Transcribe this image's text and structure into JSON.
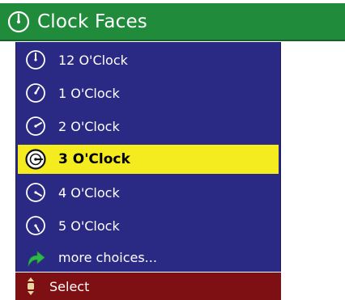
{
  "colors": {
    "title_bar": "#218b3c",
    "menu_background": "#2a2a85",
    "selection_highlight": "#f4ec1e",
    "status_bar": "#7e0f12",
    "more_choices_arrow": "#2fb84a"
  },
  "header": {
    "icon": "clock-icon",
    "title": "Clock Faces"
  },
  "menu": {
    "items": [
      {
        "label": "12 O'Clock",
        "icon": "clock-12-icon",
        "hand_angle": 0,
        "selected": false
      },
      {
        "label": "1 O'Clock",
        "icon": "clock-1-icon",
        "hand_angle": 30,
        "selected": false
      },
      {
        "label": "2 O'Clock",
        "icon": "clock-2-icon",
        "hand_angle": 60,
        "selected": false
      },
      {
        "label": "3 O'Clock",
        "icon": "clock-3-icon",
        "hand_angle": 90,
        "selected": true
      },
      {
        "label": "4 O'Clock",
        "icon": "clock-4-icon",
        "hand_angle": 120,
        "selected": false
      },
      {
        "label": "5 O'Clock",
        "icon": "clock-5-icon",
        "hand_angle": 150,
        "selected": false
      }
    ],
    "more": {
      "label": "more choices...",
      "icon": "curved-arrow-icon"
    }
  },
  "status": {
    "icon": "scroll-wheel-icon",
    "label": "Select"
  }
}
